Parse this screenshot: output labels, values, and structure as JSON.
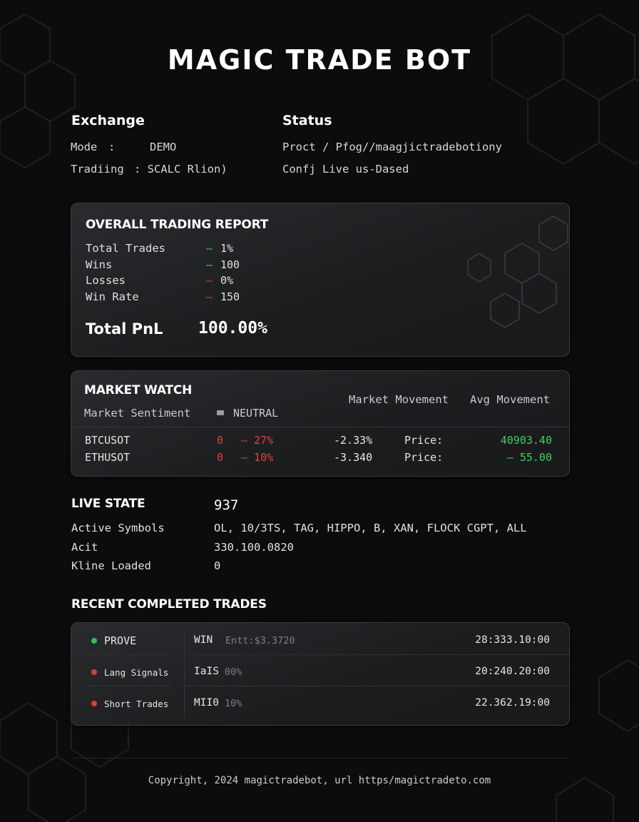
{
  "app_title": "MAGIC TRADE BOT",
  "exchange": {
    "heading": "Exchange",
    "mode_label": "Mode",
    "mode_sep": ":",
    "mode_value": "DEMO",
    "trading_label": "Tradiing",
    "trading_value": ": SCALC Rlion)"
  },
  "status": {
    "heading": "Status",
    "line1": "Proct / Pfog//maagjictradebotiony",
    "line2": "Confj Live us-Dased"
  },
  "report": {
    "heading": "OVERALL TRADING REPORT",
    "rows": [
      {
        "label": "Total Trades",
        "sign": "–",
        "value": "1%",
        "color": "green"
      },
      {
        "label": "Wins",
        "sign": "–",
        "value": "100",
        "color": "green"
      },
      {
        "label": "Losses",
        "sign": "–",
        "value": "0%",
        "color": "red"
      },
      {
        "label": "Win Rate",
        "sign": "–",
        "value": "150",
        "color": "red"
      }
    ],
    "pnl_label": "Total PnL",
    "pnl_value": "100.00%"
  },
  "market": {
    "heading": "MARKET WATCH",
    "sentiment_label": "Market Sentiment",
    "sentiment_value": "NEUTRAL",
    "col_movement": "Market Movement",
    "col_avg": "Avg Movement",
    "rows": [
      {
        "symbol": "BTCUSOT",
        "zero": "0",
        "change": "– 27%",
        "movement": "-2.33%",
        "price_label": "Price:",
        "price": "40903.40"
      },
      {
        "symbol": "ETHUSOT",
        "zero": "0",
        "change": "– 10%",
        "movement": "-3.340",
        "price_label": "Price:",
        "price": "– 55.00"
      }
    ]
  },
  "live_state": {
    "heading": "LIVE STATE",
    "heading_value": "937",
    "rows": [
      {
        "label": "Active Symbols",
        "value": "OL, 10/3TS, TAG, HIPPO, B, XAN, FLOCK CGPT, ALL"
      },
      {
        "label": "Acit",
        "value": "330.100.0820"
      },
      {
        "label": "Kline Loaded",
        "value": "0"
      }
    ]
  },
  "recent": {
    "heading": "RECENT COMPLETED TRADES",
    "rows": [
      {
        "name": "PROVE",
        "dot": "#2fc24f",
        "result": "WIN",
        "detail": "Entt:$3.3720",
        "time": "28:333.10:00"
      },
      {
        "name": "Lang Signals",
        "dot": "#e03a3a",
        "result": "IaIS",
        "detail": "00%",
        "time": "20:240.20:00"
      },
      {
        "name": "Short Trades",
        "dot": "#e03a3a",
        "result": "MII0",
        "detail": "10%",
        "time": "22.362.19:00"
      }
    ]
  },
  "footer": "Copyright, 2024 magictradebot, url https/magictradeto.com"
}
